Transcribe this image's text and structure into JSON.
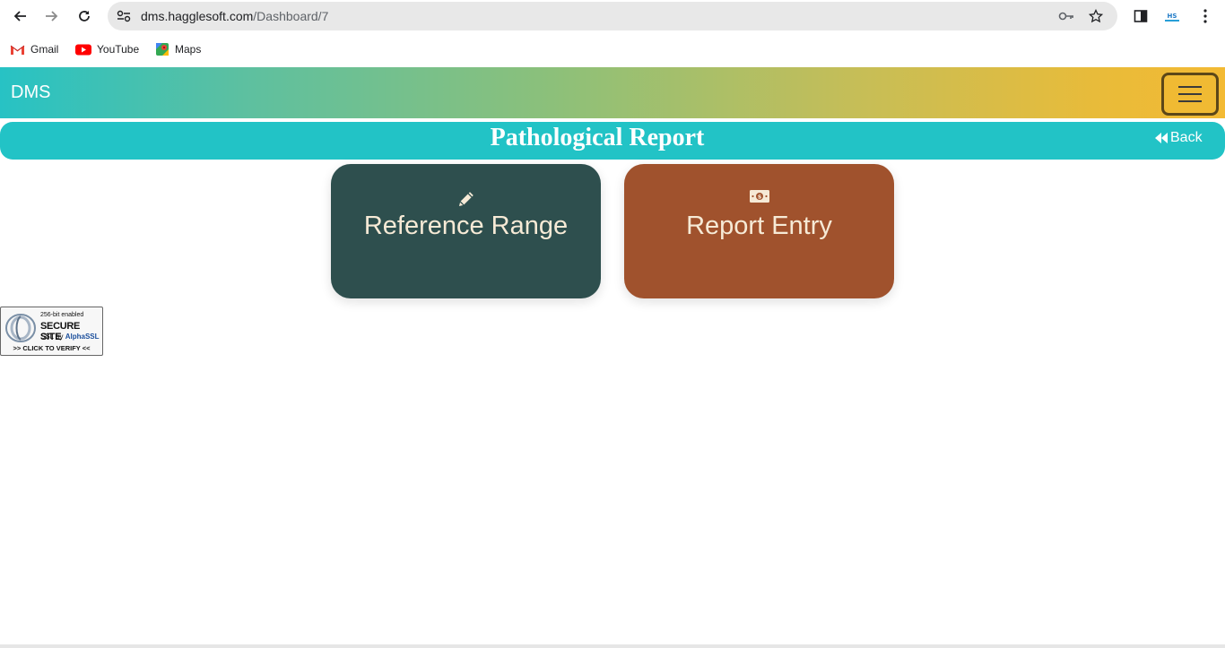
{
  "browser": {
    "url_host": "dms.hagglesoft.com",
    "url_path": "/Dashboard/7",
    "bookmarks": [
      {
        "label": "Gmail",
        "icon": "gmail-icon"
      },
      {
        "label": "YouTube",
        "icon": "youtube-icon"
      },
      {
        "label": "Maps",
        "icon": "maps-icon"
      }
    ]
  },
  "app": {
    "brand": "DMS",
    "page_title": "Pathological Report",
    "back_label": "Back",
    "cards": [
      {
        "label": "Reference Range",
        "icon": "pencil-icon",
        "color": "#2e4f4e"
      },
      {
        "label": "Report Entry",
        "icon": "money-bill-icon",
        "color": "#a0522d"
      }
    ]
  },
  "ssl_badge": {
    "line1": "256-bit enabled",
    "line2": "SECURE SITE",
    "line3_prefix": "SSL by ",
    "line3_brand": "AlphaSSL",
    "line4": ">> CLICK TO VERIFY <<"
  },
  "colors": {
    "titlebar": "#22c3c6",
    "gradient_start": "#27c2c4",
    "gradient_end": "#f3ba34"
  }
}
